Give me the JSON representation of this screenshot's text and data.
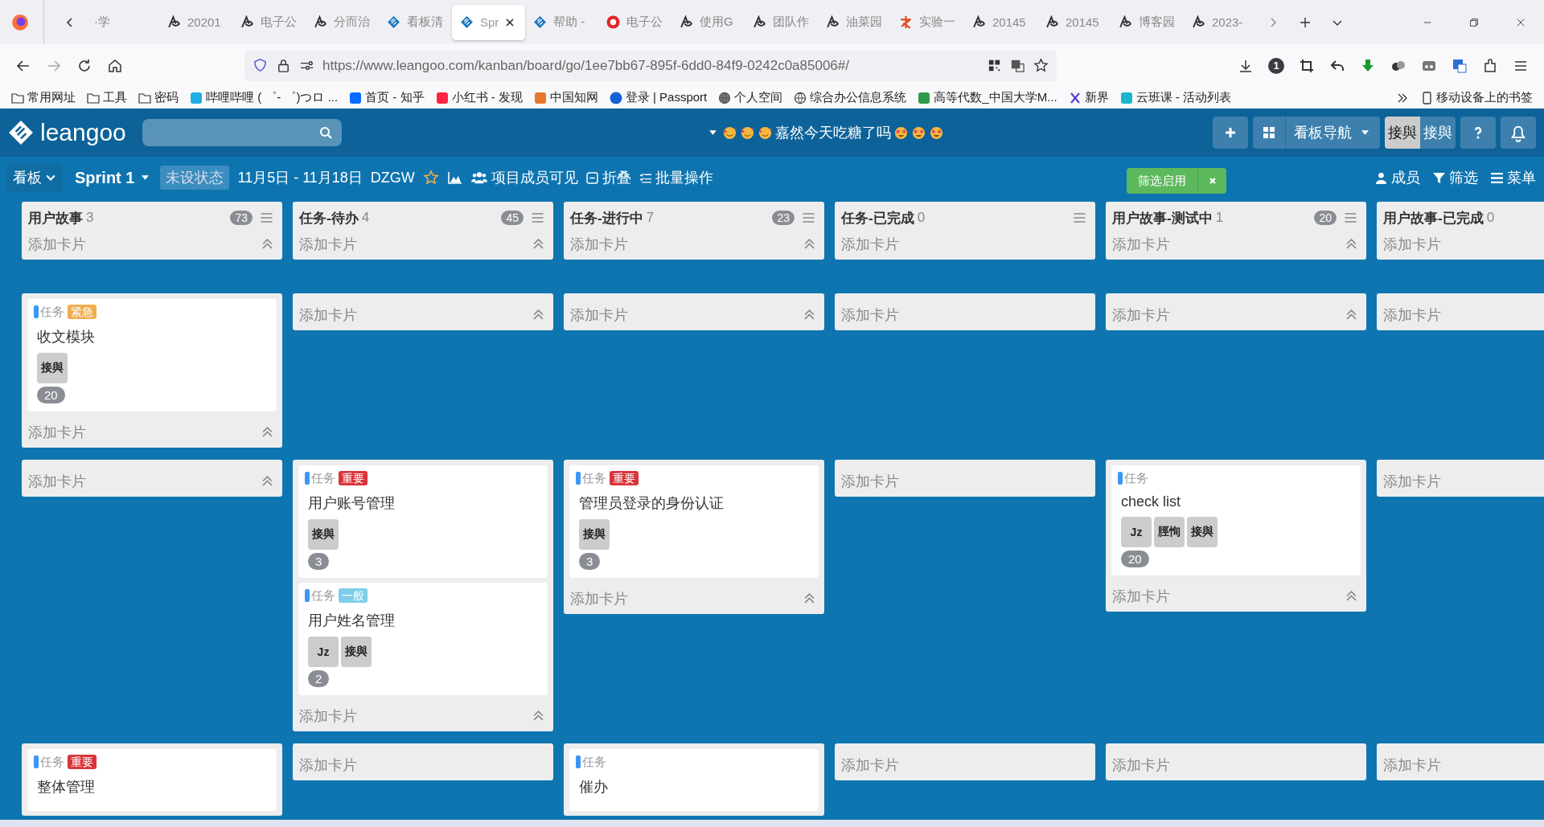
{
  "browser": {
    "tabs": [
      {
        "label": "·学",
        "kind": "none",
        "selected": false
      },
      {
        "label": "20201",
        "kind": "swirl",
        "selected": false
      },
      {
        "label": "电子公",
        "kind": "swirl",
        "selected": false
      },
      {
        "label": "分而治",
        "kind": "swirl",
        "selected": false
      },
      {
        "label": "看板清",
        "kind": "diamond",
        "selected": false
      },
      {
        "label": "Spr",
        "kind": "diamond",
        "selected": true
      },
      {
        "label": "帮助 -",
        "kind": "diamond",
        "selected": false
      },
      {
        "label": "电子公",
        "kind": "ring",
        "selected": false
      },
      {
        "label": "使用G",
        "kind": "swirl",
        "selected": false
      },
      {
        "label": "团队作",
        "kind": "swirl",
        "selected": false
      },
      {
        "label": "油菜园",
        "kind": "swirl",
        "selected": false
      },
      {
        "label": "实验一",
        "kind": "brush",
        "selected": false
      },
      {
        "label": "20145",
        "kind": "swirl",
        "selected": false
      },
      {
        "label": "20145",
        "kind": "swirl",
        "selected": false
      },
      {
        "label": "博客园",
        "kind": "swirl",
        "selected": false
      },
      {
        "label": "2023-",
        "kind": "swirl",
        "selected": false
      }
    ],
    "url": "https://www.leangoo.com/kanban/board/go/1ee7bb67-895f-6dd0-84f9-0242c0a85006#/",
    "extension_badge": "1",
    "bookmarks": [
      {
        "label": "常用网址",
        "kind": "folder"
      },
      {
        "label": "工具",
        "kind": "folder"
      },
      {
        "label": "密码",
        "kind": "folder"
      },
      {
        "label": "哔哩哔哩 ( ゜- ゜)つロ ...",
        "kind": "tv"
      },
      {
        "label": "首页 - 知乎",
        "kind": "blue-square"
      },
      {
        "label": "小红书 - 发现",
        "kind": "red-square"
      },
      {
        "label": "中国知网",
        "kind": "orange-square"
      },
      {
        "label": "登录 | Passport",
        "kind": "blue-circle"
      },
      {
        "label": "个人空间",
        "kind": "dark-circle"
      },
      {
        "label": "综合办公信息系统",
        "kind": "globe"
      },
      {
        "label": "高等代数_中国大学M...",
        "kind": "book"
      },
      {
        "label": "新界",
        "kind": "cross"
      },
      {
        "label": "云班课 - 活动列表",
        "kind": "cloud"
      }
    ],
    "mobile_bookmarks": "移动设备上的书签"
  },
  "app": {
    "logo": "leangoo",
    "board_title": "嘉然今天吃糖了吗",
    "nav_button": "看板导航",
    "users": [
      {
        "label": "接與",
        "selected": true
      },
      {
        "label": "接與",
        "selected": false
      }
    ]
  },
  "toolbar": {
    "board_menu": "看板",
    "sprint": "Sprint 1",
    "status": "未设状态",
    "dates": "11月5日 - 11月18日",
    "code": "DZGW",
    "visibility": "项目成员可见",
    "fold": "折叠",
    "batch": "批量操作",
    "filter": "筛选启用",
    "members": "成员",
    "filter_menu": "筛选",
    "menu": "菜单"
  },
  "board": {
    "columns": [
      {
        "title": "用户故事",
        "count": "3",
        "badge": "73",
        "add_card": "添加卡片",
        "collapse": true
      },
      {
        "title": "任务-待办",
        "count": "4",
        "badge": "45",
        "add_card": "添加卡片",
        "collapse": true
      },
      {
        "title": "任务-进行中",
        "count": "7",
        "badge": "23",
        "add_card": "添加卡片",
        "collapse": true
      },
      {
        "title": "任务-已完成",
        "count": "0",
        "add_card": "添加卡片",
        "collapse": false
      },
      {
        "title": "用户故事-测试中",
        "count": "1",
        "badge": "20",
        "add_card": "添加卡片",
        "collapse": true
      },
      {
        "title": "用户故事-已完成",
        "count": "0",
        "add_card": "添加卡片"
      }
    ],
    "lanes": [
      {
        "cells": [
          {
            "add_card": "添加卡片",
            "collapse": true,
            "cards": [
              {
                "type": "任务",
                "label": "紧急",
                "color": "#f0ad4e",
                "title": "收文模块",
                "members": [
                  "接與"
                ],
                "points": "20"
              }
            ]
          },
          {
            "add_card": "添加卡片",
            "collapse": true
          },
          {
            "add_card": "添加卡片",
            "collapse": true
          },
          {
            "add_card": "添加卡片",
            "collapse": false
          },
          {
            "add_card": "添加卡片",
            "collapse": true
          },
          {
            "add_card": "添加卡片"
          }
        ]
      },
      {
        "cells": [
          {
            "add_card": "添加卡片",
            "collapse": true
          },
          {
            "add_card": "添加卡片",
            "collapse": true,
            "cards": [
              {
                "type": "任务",
                "label": "重要",
                "color": "#d9343a",
                "title": "用户账号管理",
                "members": [
                  "接與"
                ],
                "points": "3"
              },
              {
                "type": "任务",
                "label": "一般",
                "color": "#7fcdea",
                "title": "用户姓名管理",
                "members": [
                  "Jz",
                  "接與"
                ],
                "points": "2"
              }
            ]
          },
          {
            "add_card": "添加卡片",
            "collapse": true,
            "cards": [
              {
                "type": "任务",
                "label": "重要",
                "color": "#d9343a",
                "title": "管理员登录的身份认证",
                "members": [
                  "接與"
                ],
                "points": "3"
              }
            ]
          },
          {
            "add_card": "添加卡片",
            "collapse": false
          },
          {
            "add_card": "添加卡片",
            "collapse": true,
            "cards": [
              {
                "type": "任务",
                "title": "check list",
                "members": [
                  "Jz",
                  "脛恂",
                  "接與"
                ],
                "points": "20"
              }
            ]
          },
          {
            "add_card": "添加卡片"
          }
        ]
      },
      {
        "cells": [
          {
            "cards": [
              {
                "type": "任务",
                "label": "重要",
                "color": "#d9343a",
                "title": "整体管理"
              }
            ]
          },
          {
            "add_card": "添加卡片",
            "collapse": false
          },
          {
            "cards": [
              {
                "type": "任务",
                "title": "催办"
              }
            ]
          },
          {
            "add_card": "添加卡片",
            "collapse": false
          },
          {
            "add_card": "添加卡片",
            "collapse": false
          },
          {
            "add_card": "添加卡片"
          }
        ]
      }
    ]
  }
}
